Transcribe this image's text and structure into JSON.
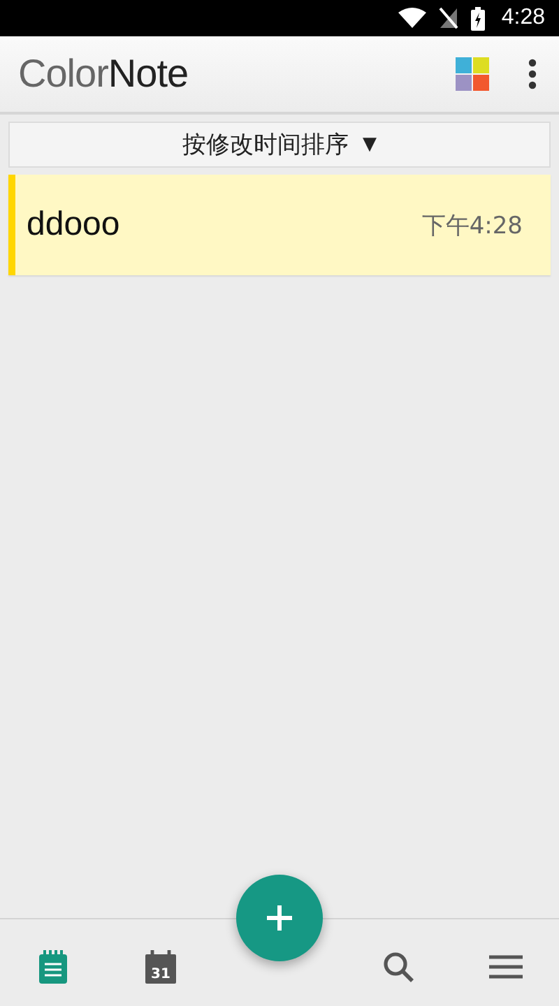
{
  "status_bar": {
    "time": "4:28"
  },
  "app_bar": {
    "logo_light": "Color",
    "logo_dark": "Note"
  },
  "sort": {
    "label": "按修改时间排序",
    "caret": "▼"
  },
  "notes": [
    {
      "title": "ddooo",
      "time": "下午4:28",
      "color": "#ffd600"
    }
  ],
  "bottom_nav": [
    {
      "kind": "notes",
      "selected": true
    },
    {
      "kind": "calendar",
      "day": "31",
      "selected": false
    },
    {
      "kind": "search",
      "selected": false
    },
    {
      "kind": "menu",
      "selected": false
    }
  ]
}
